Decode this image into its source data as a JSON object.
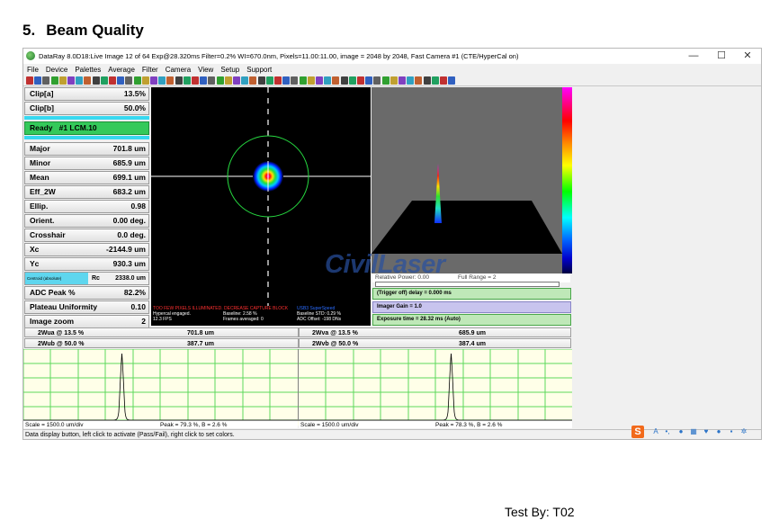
{
  "doc": {
    "section_number": "5.",
    "section_title": "Beam Quality",
    "tested_by": "Test  By:  T02"
  },
  "window": {
    "title": "DataRay 8.0D18:Live Image 12 of 64    Exp@28.320ms Filter=0.2%    WI=670.0nm, Pixels=11.00:11.00, image = 2048 by 2048, Fast   Camera #1  (CTE/HyperCal on)",
    "minimize": "—",
    "maximize": "☐",
    "close": "✕"
  },
  "menu": [
    "File",
    "Device",
    "Palettes",
    "Average",
    "Filter",
    "Camera",
    "View",
    "Setup",
    "Support"
  ],
  "left_panel": {
    "clip_a": {
      "label": "Clip[a]",
      "value": "13.5%"
    },
    "clip_b": {
      "label": "Clip[b]",
      "value": "50.0%"
    },
    "ready": {
      "label": "Ready",
      "value": "#1 LCM.10"
    },
    "major": {
      "label": "Major",
      "value": "701.8 um"
    },
    "minor": {
      "label": "Minor",
      "value": "685.9 um"
    },
    "mean": {
      "label": "Mean",
      "value": "699.1 um"
    },
    "eff_2w": {
      "label": "Eff_2W",
      "value": "683.2 um"
    },
    "ellip": {
      "label": "Ellip.",
      "value": "0.98"
    },
    "orient": {
      "label": "Orient.",
      "value": "0.00 deg."
    },
    "crosshair": {
      "label": "Crosshair",
      "value": "0.0 deg."
    },
    "xc": {
      "label": "Xc",
      "value": "-2144.9 um"
    },
    "yc": {
      "label": "Yc",
      "value": "930.3 um"
    },
    "rc": {
      "button": "Centroid (absolute)",
      "label": "Rc",
      "value": "2338.0 um"
    },
    "adc_peak": {
      "label": "ADC Peak %",
      "value": "82.2%"
    },
    "plateau": {
      "label": "Plateau Uniformity",
      "value": "0.10"
    },
    "zoom": {
      "label": "Image zoom",
      "value": "2"
    }
  },
  "beam_status": {
    "warning": "TOO FEW PIXELS ILLUMINATED. DECREASE CAPTURE BLOCK",
    "usb": "USB3 SuperSpeed",
    "hypercal": "Hypercal engaged.",
    "fps": "12.3 FPS",
    "baseline": "Baseline: 2.58 %",
    "frames": "Frames averaged: 0",
    "baseline_std": "Baseline STD:  0.29 %",
    "adc_offset": "ADC Offset:  -198 DNs"
  },
  "power": {
    "relative": "Relative Power: 0.00",
    "full_range": "Full Range = 2"
  },
  "controls": {
    "trigger": "(Trigger off) delay = 0.000 ms",
    "gain": "Imager Gain = 1.0",
    "exposure": "Exposure time = 28.32 ms (Auto)"
  },
  "lower_fields": {
    "wua": {
      "label": "2Wua @ 13.5 %",
      "value": "701.8 um"
    },
    "wva": {
      "label": "2Wva @ 13.5 %",
      "value": "685.9 um"
    },
    "wub": {
      "label": "2Wub @ 50.0 %",
      "value": "387.7 um"
    },
    "wvb": {
      "label": "2Wvb @ 50.0 %",
      "value": "387.4 um"
    }
  },
  "profile_footers": {
    "left_scale": "Scale = 1500.0 um/div",
    "left_peak": "Peak = 79.3 %,  B = 2.6 %",
    "right_scale": "Scale = 1500.0 um/div",
    "right_peak": "Peak = 78.3 %,  B = 2.6 %"
  },
  "status_bar": "Data display button, left click to activate (Pass/Fail), right click to set colors.",
  "watermark": "CivilLaser",
  "colors": {
    "ready_green": "#34c95a",
    "cyan_accent": "#38d8f0",
    "grid_green": "#5cd85c",
    "control_green": "#bfe8b8",
    "control_purple": "#c8c4ee"
  }
}
